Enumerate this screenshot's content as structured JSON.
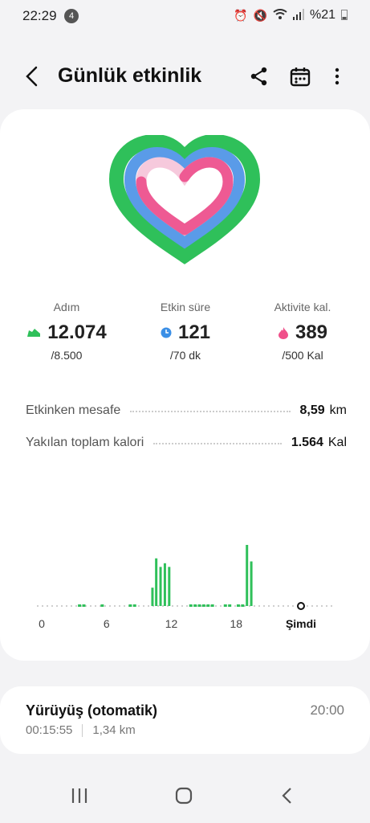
{
  "status": {
    "time": "22:29",
    "notif_count": "4",
    "battery": "%21"
  },
  "header": {
    "title": "Günlük etkinlik"
  },
  "stats": [
    {
      "label": "Adım",
      "value": "12.074",
      "goal": "/8.500",
      "icon": "shoe-icon",
      "color": "#2fc05a"
    },
    {
      "label": "Etkin süre",
      "value": "121",
      "goal": "/70 dk",
      "icon": "clock-icon",
      "color": "#3b8fe6"
    },
    {
      "label": "Aktivite kal.",
      "value": "389",
      "goal": "/500 Kal",
      "icon": "flame-icon",
      "color": "#f0508a"
    }
  ],
  "rows": [
    {
      "label": "Etkinken mesafe",
      "value": "8,59",
      "unit": "km"
    },
    {
      "label": "Yakılan toplam kalori",
      "value": "1.564",
      "unit": "Kal"
    }
  ],
  "chart_data": {
    "type": "bar",
    "x_ticks": [
      "0",
      "6",
      "12",
      "18",
      "Şimdi"
    ],
    "bars": [
      {
        "hour": 10.25,
        "value": 0.3
      },
      {
        "hour": 10.6,
        "value": 0.78
      },
      {
        "hour": 11.0,
        "value": 0.64
      },
      {
        "hour": 11.4,
        "value": 0.7
      },
      {
        "hour": 11.8,
        "value": 0.64
      },
      {
        "hour": 19.0,
        "value": 1.0
      },
      {
        "hour": 19.4,
        "value": 0.73
      }
    ],
    "low_activity_hours": [
      3.5,
      3.9,
      5.6,
      8.2,
      8.6,
      13.8,
      14.2,
      14.6,
      15.0,
      15.4,
      15.8,
      17.0,
      17.4,
      18.2,
      18.6
    ],
    "heart_rings": {
      "steps": 1.0,
      "active_time": 1.0,
      "calories": 0.78
    }
  },
  "activity": {
    "name": "Yürüyüş (otomatik)",
    "time": "20:00",
    "duration": "00:15:55",
    "distance": "1,34 km"
  },
  "colors": {
    "green": "#2fc05a",
    "blue": "#5a9be8",
    "pink": "#ee5a93"
  }
}
